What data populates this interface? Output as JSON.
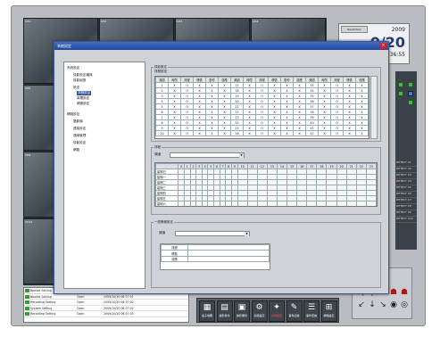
{
  "window": {
    "title": "",
    "clock_button": "Reset/Gen",
    "year": "2009",
    "date": "0/20",
    "time": "36:55"
  },
  "cameras": [
    {
      "label": "CH1"
    },
    {
      "label": "CH2"
    },
    {
      "label": "CH3"
    },
    {
      "label": "CH4"
    },
    {
      "label": "CH5"
    },
    {
      "label": "CH6"
    },
    {
      "label": "CH7"
    },
    {
      "label": "CH8"
    },
    {
      "label": "CH9"
    },
    {
      "label": "CH10"
    },
    {
      "label": "CH11"
    },
    {
      "label": "CH12"
    },
    {
      "label": "CH13"
    },
    {
      "label": "CH14"
    },
    {
      "label": "CH15"
    },
    {
      "label": "CH16"
    }
  ],
  "dialog": {
    "title": "系統設定",
    "tree": [
      "系統設定",
      "錄影設定檔與",
      "錄影組態",
      "設定",
      "排程設定",
      "時間設定",
      "硬碟設定",
      "網路設定",
      "攝影機",
      "連接設定",
      "連線管理",
      "錄影設定",
      "網路"
    ],
    "group_main": "錄影設定",
    "group_sub": "排程設定",
    "table_headers": [
      "頻道",
      "時間",
      "排程",
      "移動",
      "動作",
      "感應",
      "頻道",
      "時間",
      "排程",
      "移動",
      "動作",
      "感應",
      "頻道",
      "時間",
      "排程",
      "移動",
      "感應"
    ],
    "table_rows": [
      [
        "1",
        "X",
        "O",
        "X",
        "X",
        "X",
        "17",
        "X",
        "O",
        "X",
        "X",
        "X",
        "33",
        "X",
        "O",
        "X",
        "X"
      ],
      [
        "2",
        "X",
        "O",
        "X",
        "X",
        "X",
        "18",
        "X",
        "O",
        "X",
        "X",
        "X",
        "34",
        "X",
        "O",
        "X",
        "X"
      ],
      [
        "3",
        "X",
        "O",
        "X",
        "X",
        "X",
        "19",
        "X",
        "O",
        "X",
        "X",
        "X",
        "35",
        "X",
        "O",
        "X",
        "X"
      ],
      [
        "4",
        "X",
        "O",
        "X",
        "X",
        "X",
        "20",
        "X",
        "O",
        "X",
        "X",
        "X",
        "36",
        "X",
        "O",
        "X",
        "X"
      ],
      [
        "5",
        "X",
        "O",
        "X",
        "X",
        "X",
        "21",
        "X",
        "O",
        "X",
        "X",
        "X",
        "37",
        "X",
        "O",
        "X",
        "X"
      ],
      [
        "6",
        "X",
        "O",
        "X",
        "X",
        "X",
        "22",
        "X",
        "O",
        "X",
        "X",
        "X",
        "38",
        "X",
        "O",
        "X",
        "X"
      ],
      [
        "7",
        "X",
        "O",
        "X",
        "X",
        "X",
        "23",
        "X",
        "O",
        "X",
        "X",
        "X",
        "39",
        "X",
        "O",
        "X",
        "X"
      ],
      [
        "8",
        "X",
        "O",
        "X",
        "X",
        "X",
        "24",
        "X",
        "O",
        "X",
        "X",
        "X",
        "40",
        "X",
        "O",
        "X",
        "X"
      ],
      [
        "9",
        "X",
        "O",
        "X",
        "X",
        "X",
        "25",
        "X",
        "O",
        "X",
        "X",
        "X",
        "41",
        "X",
        "O",
        "X",
        "X"
      ],
      [
        "10",
        "X",
        "O",
        "X",
        "X",
        "X",
        "26",
        "X",
        "O",
        "X",
        "X",
        "X",
        "42",
        "X",
        "O",
        "X",
        "X"
      ]
    ],
    "schedule_group": "排程",
    "schedule_label": "頻道",
    "hours": [
      "0",
      "1",
      "2",
      "3",
      "4",
      "5",
      "6",
      "7",
      "8",
      "9",
      "10",
      "11",
      "12",
      "13",
      "14",
      "15",
      "16",
      "17",
      "18",
      "19",
      "20",
      "21",
      "22",
      "23"
    ],
    "days": [
      "星期日",
      "星期一",
      "星期二",
      "星期三",
      "星期四",
      "星期五",
      "星期六"
    ],
    "alarm_group": "一般警報設定",
    "alarm_label": "頻道",
    "detail_rows": [
      "排程",
      "移動",
      "感應"
    ]
  },
  "toolbar": [
    {
      "label": "電子地圖",
      "icon": "▦"
    },
    {
      "label": "錄影搜尋",
      "icon": "▤"
    },
    {
      "label": "錄影備份",
      "icon": "▣"
    },
    {
      "label": "系統設定",
      "icon": "⚙"
    },
    {
      "label": "系統設定",
      "icon": "✦"
    },
    {
      "label": "事件記錄",
      "icon": "✎"
    },
    {
      "label": "事件查詢",
      "icon": "☰"
    },
    {
      "label": "網路設定",
      "icon": "⊞"
    }
  ],
  "event_log": [
    {
      "name": "Booted Setting",
      "state": "Open",
      "time": "2009/10/20 06:37:01"
    },
    {
      "name": "Booted Setting",
      "state": "Open",
      "time": "2009/10/20 06:37:01"
    },
    {
      "name": "Recording Setting",
      "state": "Open",
      "time": "2009/10/20 06:37:02"
    },
    {
      "name": "System Setting",
      "state": "Open",
      "time": "2009/10/20 06:37:02"
    },
    {
      "name": "Recording Setting",
      "state": "Open",
      "time": "2009/10/20 06:37:03"
    }
  ],
  "sidelist": [
    "DETECT C1",
    "DETECT C2",
    "DETECT C3",
    "DETECT C4",
    "DETECT C5",
    "DETECT C6",
    "DETECT C7",
    "DETECT C8",
    "DETECT C9",
    "DETECT C10"
  ],
  "colors": {
    "accent": "#2a4d9b",
    "title_bar": "#3f6fc0",
    "status_ok": "#3c9a3c",
    "alert": "#b01818"
  }
}
